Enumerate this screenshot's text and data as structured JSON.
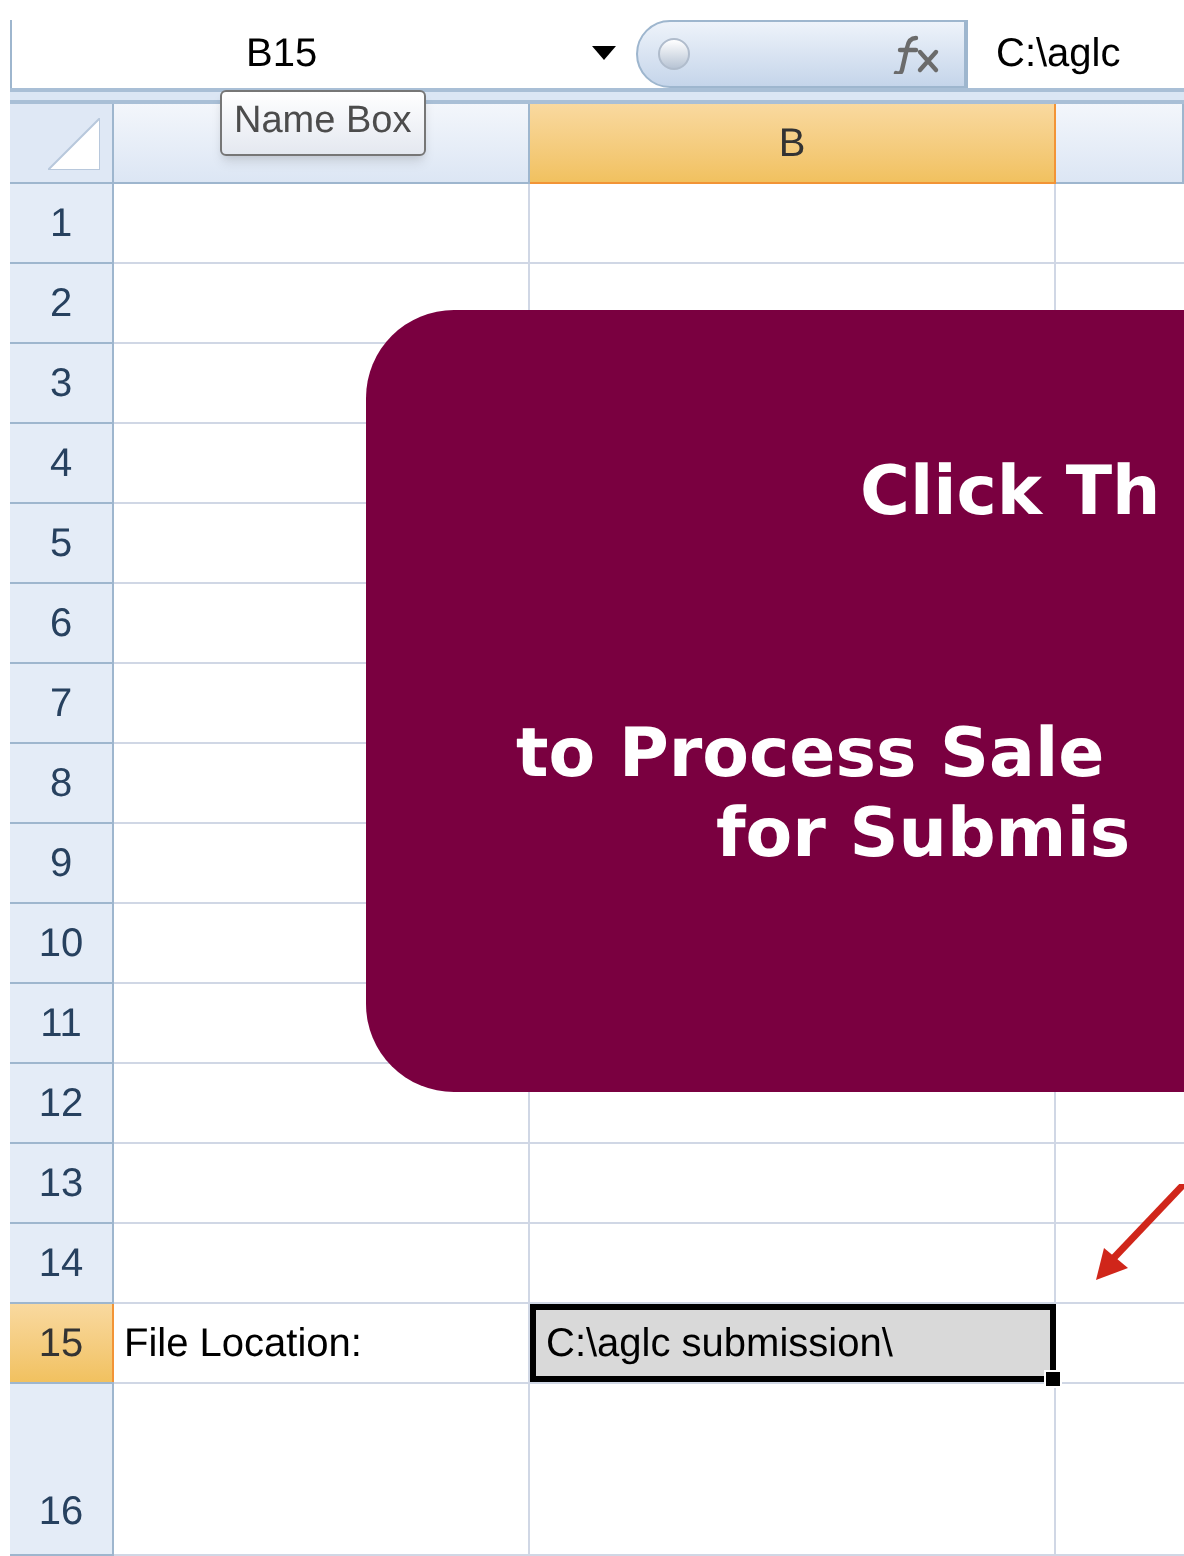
{
  "formula_bar": {
    "name_box": "B15",
    "formula": "C:\\aglc"
  },
  "tooltip": "Name Box",
  "columns": [
    {
      "selected": false
    },
    {
      "label": "B",
      "selected": true
    },
    {
      "selected": false
    }
  ],
  "rows": [
    {
      "label": "1",
      "selected": false
    },
    {
      "label": "2",
      "selected": false
    },
    {
      "label": "3",
      "selected": false
    },
    {
      "label": "4",
      "selected": false
    },
    {
      "label": "5",
      "selected": false
    },
    {
      "label": "6",
      "selected": false
    },
    {
      "label": "7",
      "selected": false
    },
    {
      "label": "8",
      "selected": false
    },
    {
      "label": "9",
      "selected": false
    },
    {
      "label": "10",
      "selected": false
    },
    {
      "label": "11",
      "selected": false
    },
    {
      "label": "12",
      "selected": false
    },
    {
      "label": "13",
      "selected": false
    },
    {
      "label": "14",
      "selected": false
    },
    {
      "label": "15",
      "selected": true,
      "cells": [
        {
          "text": "File Location:",
          "selected": false
        },
        {
          "text": "C:\\aglc submission\\",
          "selected": true
        }
      ]
    },
    {
      "label": "16",
      "selected": false
    }
  ],
  "macro_button": {
    "lines": [
      "Click Th",
      "to Process Sale",
      "for Submis"
    ]
  }
}
